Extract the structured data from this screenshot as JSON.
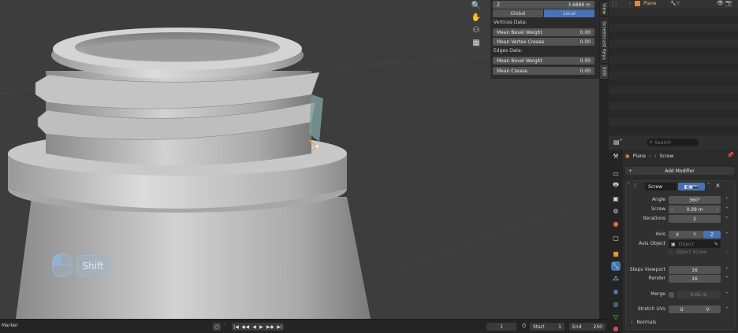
{
  "npanel": {
    "z_label": "Z",
    "z_value": "3.6889 m",
    "global_label": "Global",
    "local_label": "Local",
    "vertices_header": "Vertices Data:",
    "mean_bevel_weight_label": "Mean Bevel Weight",
    "mean_bevel_weight_value": "0.00",
    "mean_vertex_crease_label": "Mean Vertex Crease",
    "mean_vertex_crease_value": "0.00",
    "edges_header": "Edges Data:",
    "edge_bevel_weight_label": "Mean Bevel Weight",
    "edge_bevel_weight_value": "0.00",
    "mean_crease_label": "Mean Crease",
    "mean_crease_value": "0.00"
  },
  "side_tabs": {
    "view": "View",
    "screencast_keys": "Screencast Keys",
    "edit": "Edit"
  },
  "screencast": {
    "key_label": "Shift"
  },
  "outliner": {
    "object_name": "Plane"
  },
  "properties": {
    "search_placeholder": "Search",
    "breadcrumb_object": "Plane",
    "breadcrumb_modifier": "Screw",
    "add_modifier": "Add Modifier",
    "modifier_name": "Screw",
    "angle_label": "Angle",
    "angle_value": "360°",
    "screw_label": "Screw",
    "screw_value": "0.09 m",
    "iterations_label": "Iterations",
    "iterations_value": "2",
    "axis_label": "Axis",
    "axis_x": "X",
    "axis_y": "Y",
    "axis_z": "Z",
    "axis_object_label": "Axis Object",
    "axis_object_placeholder": "Object",
    "object_screw_label": "Object Screw",
    "steps_viewport_label": "Steps Viewport",
    "steps_viewport_value": "16",
    "render_label": "Render",
    "render_value": "16",
    "merge_label": "Merge",
    "merge_value": "0.01 m",
    "stretch_uvs_label": "Stretch UVs",
    "stretch_u": "U",
    "stretch_v": "V",
    "normals_label": "Normals"
  },
  "timeline": {
    "marker_label": "Marker",
    "current_frame": "1",
    "start_label": "Start",
    "start_value": "1",
    "end_label": "End",
    "end_value": "250"
  },
  "colors": {
    "accent_blue": "#4772b3",
    "viewport_bg": "#3d3d3d",
    "panel_bg": "#2b2b2b",
    "field_bg": "#545454"
  }
}
